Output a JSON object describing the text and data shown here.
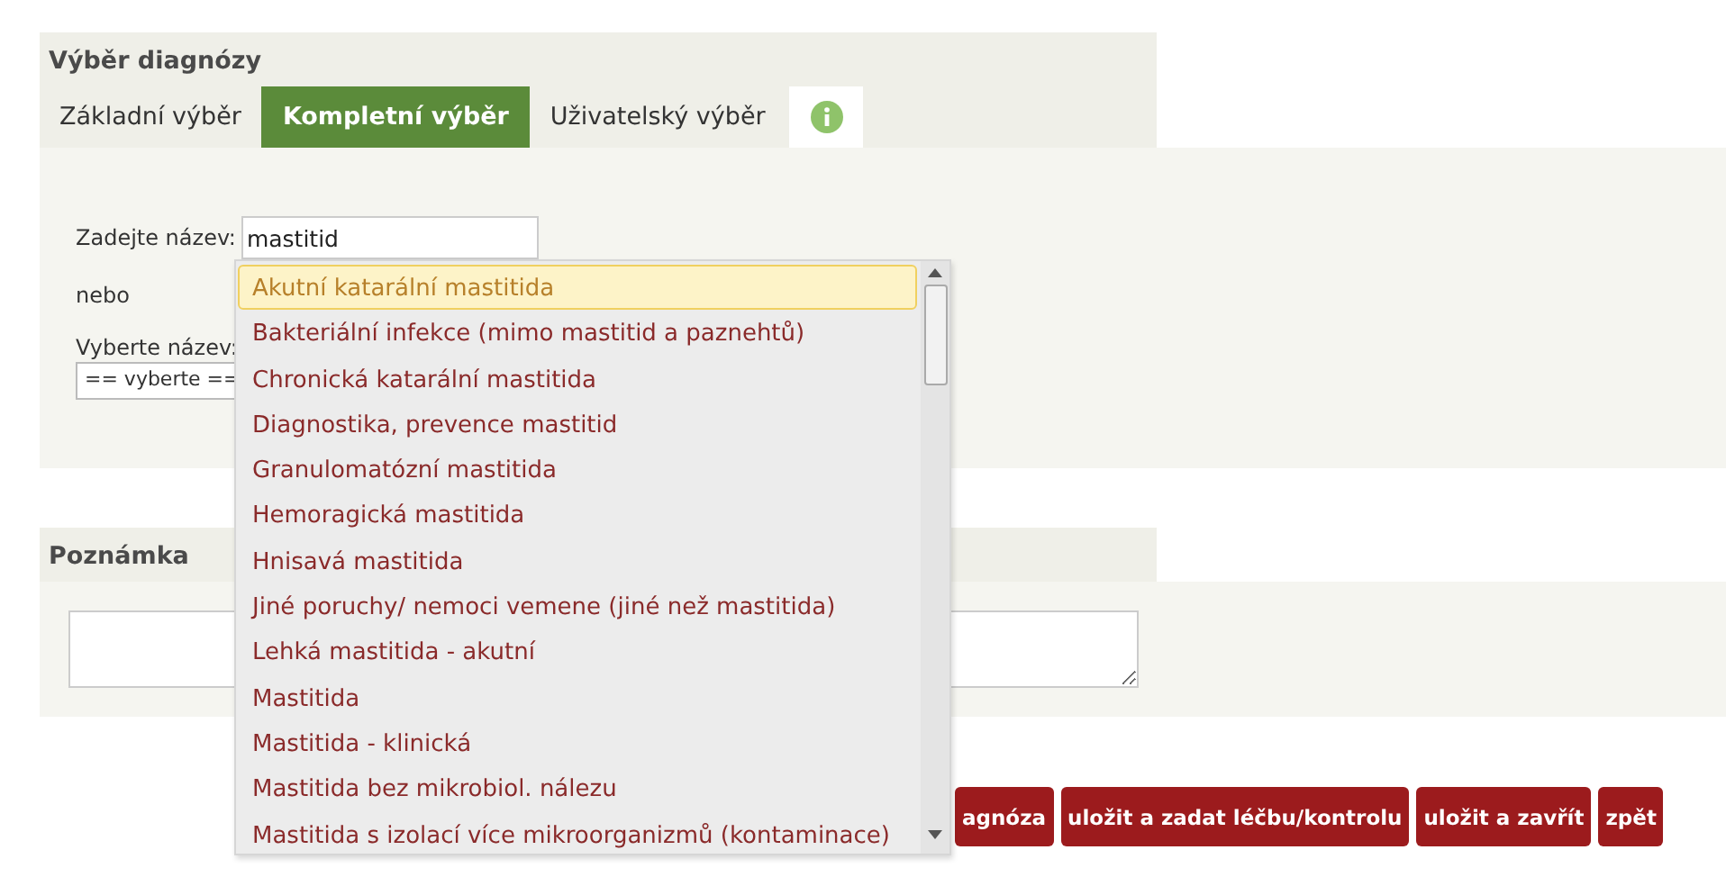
{
  "diagnosis_panel": {
    "title": "Výběr diagnózy",
    "tabs": [
      {
        "kind": "text",
        "label": "Základní výběr",
        "selected": false
      },
      {
        "kind": "text",
        "label": "Kompletní výběr",
        "selected": true
      },
      {
        "kind": "text",
        "label": "Uživatelský výběr",
        "selected": false
      },
      {
        "kind": "info",
        "selected": false
      }
    ],
    "name_label": "Zadejte název:",
    "name_value": "mastitid",
    "or_text": "nebo",
    "select_label": "Vyberte název:",
    "select_value": "== vyberte =="
  },
  "autocomplete": {
    "items": [
      {
        "label": "Akutní katarální mastitida",
        "selected": true
      },
      {
        "label": "Bakteriální infekce (mimo mastitid a paznehtů)",
        "selected": false
      },
      {
        "label": "Chronická katarální mastitida",
        "selected": false
      },
      {
        "label": "Diagnostika, prevence mastitid",
        "selected": false
      },
      {
        "label": "Granulomatózní mastitida",
        "selected": false
      },
      {
        "label": "Hemoragická mastitida",
        "selected": false
      },
      {
        "label": "Hnisavá mastitida",
        "selected": false
      },
      {
        "label": "Jiné poruchy/ nemoci vemene (jiné než mastitida)",
        "selected": false
      },
      {
        "label": "Lehká mastitida - akutní",
        "selected": false
      },
      {
        "label": "Mastitida",
        "selected": false
      },
      {
        "label": "Mastitida - klinická",
        "selected": false
      },
      {
        "label": "Mastitida bez mikrobiol. nálezu",
        "selected": false
      },
      {
        "label": "Mastitida s izolací více mikroorganizmů (kontaminace)",
        "selected": false
      }
    ]
  },
  "note_panel": {
    "title": "Poznámka"
  },
  "buttons": [
    "agnóza",
    "uložit a zadat léčbu/kontrolu",
    "uložit a zavřít",
    "zpět"
  ]
}
